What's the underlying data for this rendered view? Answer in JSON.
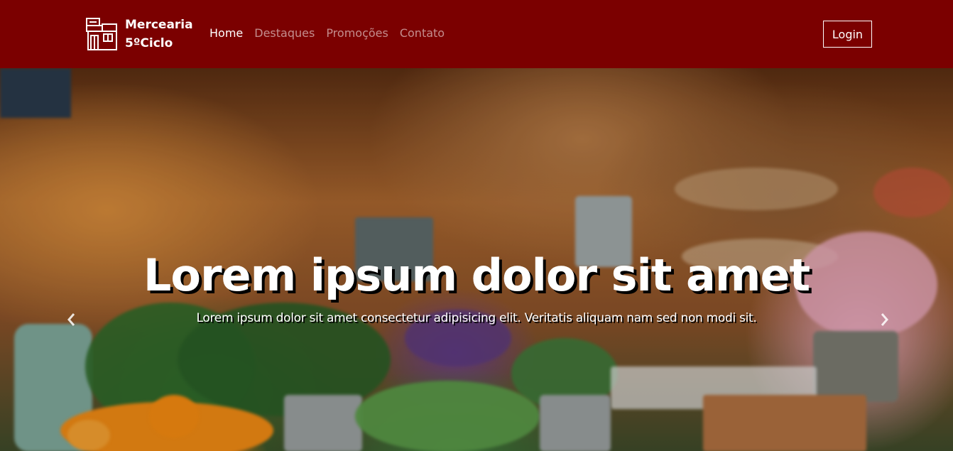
{
  "navbar": {
    "brand_line1": "Mercearia",
    "brand_line2": "5ºCiclo",
    "brand_icon": "storefront-icon",
    "links": [
      {
        "label": "Home",
        "active": true
      },
      {
        "label": "Destaques",
        "active": false
      },
      {
        "label": "Promoções",
        "active": false
      },
      {
        "label": "Contato",
        "active": false
      }
    ],
    "login_label": "Login"
  },
  "carousel": {
    "title": "Lorem ipsum dolor sit amet",
    "text": "Lorem ipsum dolor sit amet consectetur adipisicing elit. Veritatis aliquam nam sed non modi sit.",
    "prev_icon": "chevron-left-icon",
    "next_icon": "chevron-right-icon"
  },
  "colors": {
    "navbar_bg": "#7b0000",
    "text": "#ffffff"
  }
}
